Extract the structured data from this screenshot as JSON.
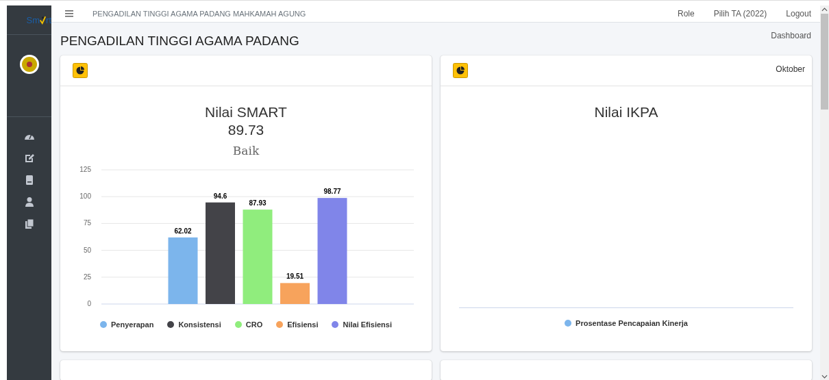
{
  "logo": {
    "left": "Sm",
    "right": "rt"
  },
  "topbar": {
    "title": "PENGADILAN TINGGI AGAMA PADANG MAHKAMAH AGUNG",
    "links": [
      "Role",
      "Pilih TA (2022)",
      "Logout"
    ]
  },
  "sidebar": {
    "items": [
      {
        "kind": "gauge"
      },
      {
        "kind": "edit"
      },
      {
        "kind": "book"
      },
      {
        "kind": "user"
      },
      {
        "kind": "copy"
      }
    ]
  },
  "page_title": "PENGADILAN TINGGI AGAMA PADANG",
  "breadcrumb": "Dashboard",
  "cards": [
    {
      "kind": "bar_chart",
      "heading_value": "89.73",
      "heading_grade": "Baik",
      "chart_data": {
        "type": "bar",
        "title": "Nilai SMART",
        "ylim": [
          0,
          125
        ],
        "yticks": [
          0,
          25,
          50,
          75,
          100,
          125
        ],
        "data_labels": true,
        "grid": true,
        "legend": "bottom",
        "series": [
          {
            "name": "Penyerapan",
            "color": "#7cb5ec",
            "values": [
              62.02
            ]
          },
          {
            "name": "Konsistensi",
            "color": "#434348",
            "values": [
              94.6
            ]
          },
          {
            "name": "CRO",
            "color": "#90ed7d",
            "values": [
              87.93
            ]
          },
          {
            "name": "Efisiensi",
            "color": "#f7a35c",
            "values": [
              19.51
            ]
          },
          {
            "name": "Nilai Efisiensi",
            "color": "#8085e9",
            "values": [
              98.77
            ]
          }
        ]
      }
    },
    {
      "kind": "empty_chart",
      "period": "Oktober",
      "title": "Nilai IKPA",
      "legend": [
        {
          "label": "Prosentase Pencapaian Kinerja",
          "color": "#7cb5ec"
        }
      ]
    }
  ]
}
